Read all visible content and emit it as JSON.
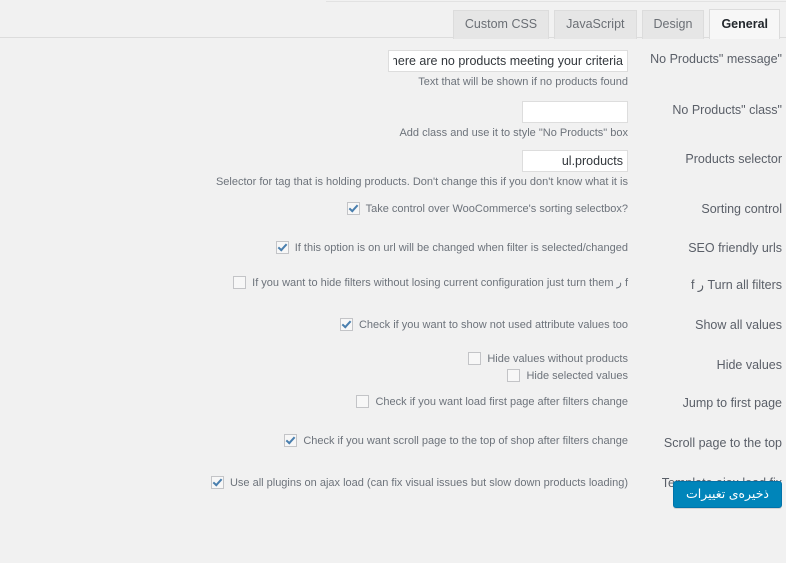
{
  "tabs": [
    {
      "label": "Custom CSS",
      "active": false
    },
    {
      "label": "JavaScript",
      "active": false
    },
    {
      "label": "Design",
      "active": false
    },
    {
      "label": "General",
      "active": true
    }
  ],
  "colors": {
    "page_background": "#f1f1f1",
    "accent_button": "#0085ba",
    "checkbox_check": "#4a7fae",
    "tab_inactive": "#e6e6e6",
    "tab_active": "#f7f7f7"
  },
  "rows": [
    {
      "id": "no-products-message",
      "label": "No Products\" message\"",
      "type": "text",
      "value": "There are no products meeting your criteria",
      "placeholder": "",
      "description": "Text that will be shown if no products found"
    },
    {
      "id": "no-products-class",
      "label": "No Products\" class\"",
      "type": "text",
      "value": "",
      "placeholder": "",
      "description": "Add class and use it to style \"No Products\" box"
    },
    {
      "id": "products-selector",
      "label": "Products selector",
      "type": "text",
      "value": "ul.products",
      "placeholder": "",
      "description": "Selector for tag that is holding products. Don't change this if you don't know what it is"
    },
    {
      "id": "sorting-control",
      "label": "Sorting control",
      "type": "checkbox",
      "options": [
        {
          "text": "?Take control over WooCommerce's sorting selectbox",
          "checked": true
        }
      ]
    },
    {
      "id": "seo-friendly-urls",
      "label": "SEO friendly urls",
      "type": "checkbox",
      "options": [
        {
          "text": "If this option is on url will be changed when filter is selected/changed",
          "checked": true
        }
      ]
    },
    {
      "id": "turn-all-filters",
      "label": "f ر Turn all filters",
      "type": "checkbox",
      "options": [
        {
          "text": "f ر If you want to hide filters without losing current configuration just turn them",
          "checked": false
        }
      ]
    },
    {
      "id": "show-all-values",
      "label": "Show all values",
      "type": "checkbox",
      "options": [
        {
          "text": "Check if you want to show not used attribute values too",
          "checked": true
        }
      ]
    },
    {
      "id": "hide-values",
      "label": "Hide values",
      "type": "checkbox",
      "options": [
        {
          "text": "Hide values without products",
          "checked": false
        },
        {
          "text": "Hide selected values",
          "checked": false
        }
      ]
    },
    {
      "id": "jump-to-first-page",
      "label": "Jump to first page",
      "type": "checkbox",
      "options": [
        {
          "text": "Check if you want load first page after filters change",
          "checked": false
        }
      ]
    },
    {
      "id": "scroll-page-to-the-top",
      "label": "Scroll page to the top",
      "type": "checkbox",
      "options": [
        {
          "text": "Check if you want scroll page to the top of shop after filters change",
          "checked": true
        }
      ]
    },
    {
      "id": "template-ajax-load-fix",
      "label": "Template ajax load fix",
      "type": "checkbox",
      "options": [
        {
          "text": "Use all plugins on ajax load (can fix visual issues but slow down products loading)",
          "checked": true
        }
      ]
    }
  ],
  "submit": {
    "label": "ذخیره‌ی تغییرات"
  }
}
